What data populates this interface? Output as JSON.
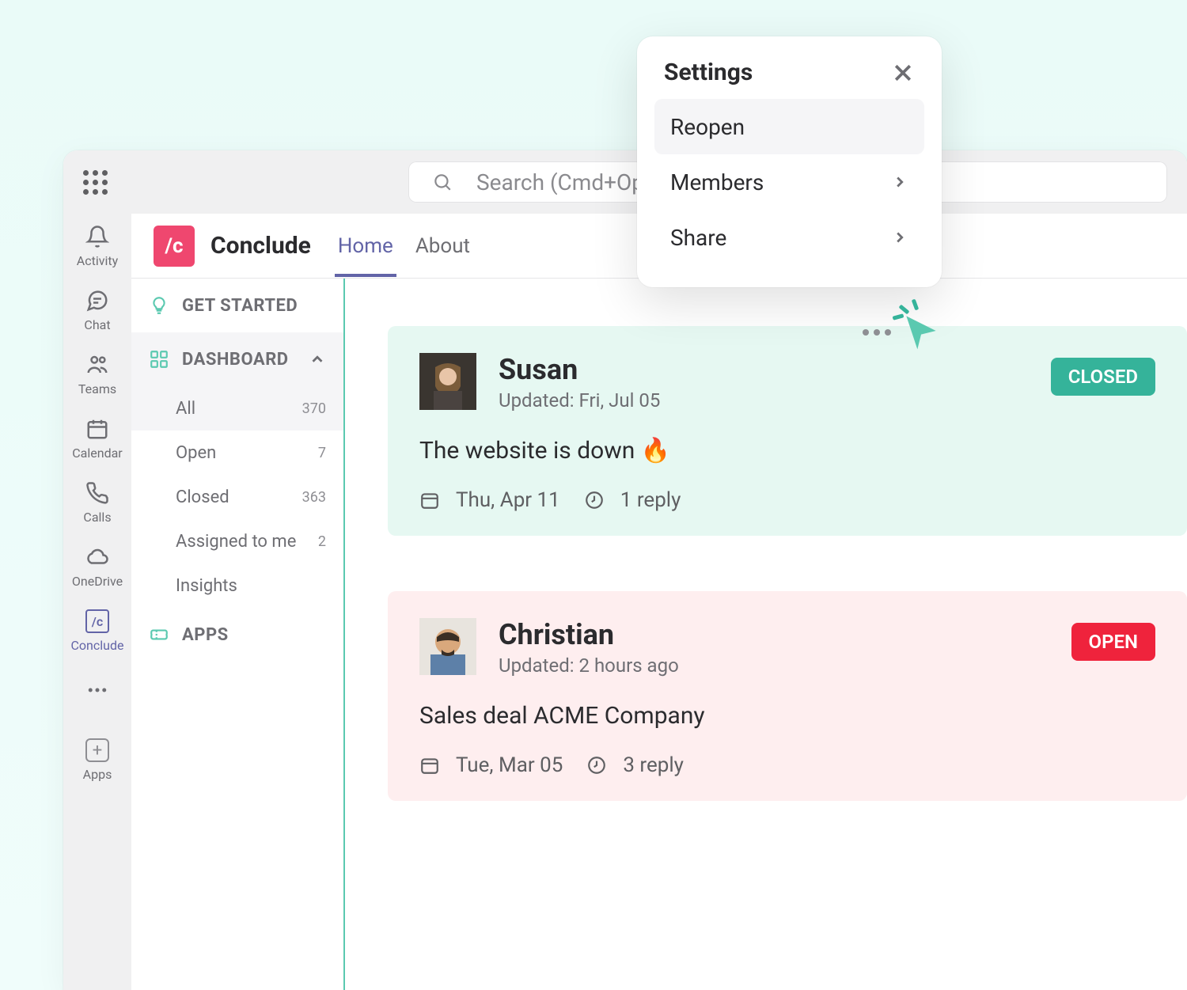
{
  "search": {
    "placeholder": "Search (Cmd+Opt+E)"
  },
  "rail": {
    "items": [
      {
        "label": "Activity"
      },
      {
        "label": "Chat"
      },
      {
        "label": "Teams"
      },
      {
        "label": "Calendar"
      },
      {
        "label": "Calls"
      },
      {
        "label": "OneDrive"
      },
      {
        "label": "Conclude"
      },
      {
        "label": "Apps"
      }
    ]
  },
  "app": {
    "logo_text": "/c",
    "title": "Conclude",
    "tabs": [
      {
        "label": "Home"
      },
      {
        "label": "About"
      }
    ]
  },
  "nav": {
    "get_started": "GET STARTED",
    "dashboard": "DASHBOARD",
    "apps": "APPS",
    "items": [
      {
        "label": "All",
        "count": "370"
      },
      {
        "label": "Open",
        "count": "7"
      },
      {
        "label": "Closed",
        "count": "363"
      },
      {
        "label": "Assigned to me",
        "count": "2"
      },
      {
        "label": "Insights",
        "count": ""
      }
    ]
  },
  "feed": {
    "cards": [
      {
        "name": "Susan",
        "updated": "Updated: Fri, Jul 05",
        "status": "CLOSED",
        "body": "The website is down 🔥",
        "date": "Thu, Apr 11",
        "replies": "1 reply"
      },
      {
        "name": "Christian",
        "updated": "Updated: 2 hours ago",
        "status": "OPEN",
        "body": "Sales deal ACME Company",
        "date": "Tue, Mar 05",
        "replies": "3 reply"
      }
    ]
  },
  "popover": {
    "title": "Settings",
    "items": [
      {
        "label": "Reopen"
      },
      {
        "label": "Members"
      },
      {
        "label": "Share"
      }
    ]
  }
}
